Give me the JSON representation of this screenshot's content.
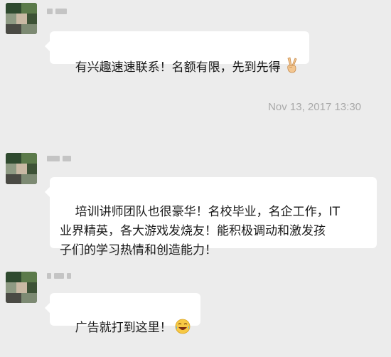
{
  "messages": [
    {
      "text": "有兴趣速速联系！名额有限，先到先得",
      "trailing_icon": "victory-hand-emoji"
    },
    {
      "text": "培训讲师团队也很豪华！名校毕业，名企工作，IT\n业界精英，各大游戏发烧友！能积极调动和激发孩\n子们的学习热情和创造能力！"
    },
    {
      "text": "广告就打到这里！",
      "trailing_icon": "laughing-emoji"
    }
  ],
  "timestamp": "Nov 13, 2017 13:30",
  "colors": {
    "background": "#ececec",
    "bubble": "#ffffff",
    "timestamp_text": "#a9a9a9"
  }
}
